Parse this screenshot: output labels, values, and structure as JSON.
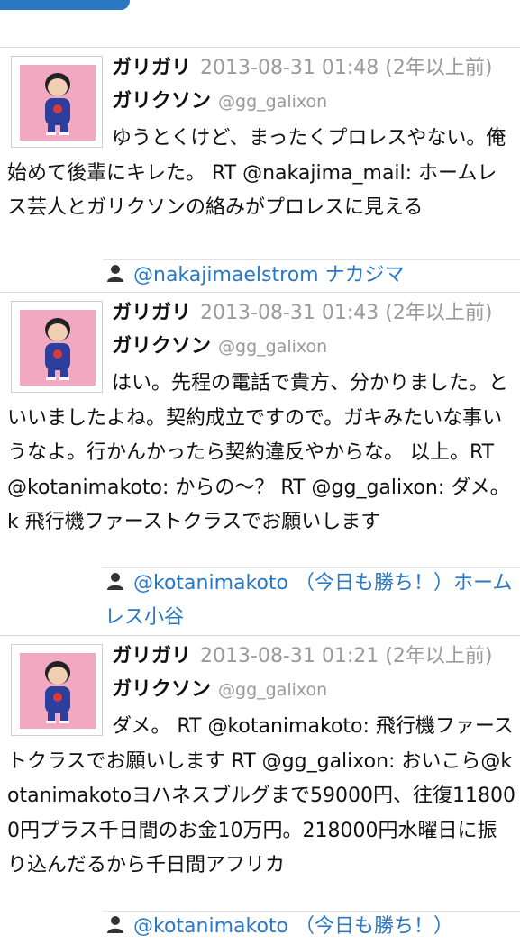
{
  "tweets": [
    {
      "name": "ガリガリ",
      "date": "2013-08-31 01:48 (2年以上前)",
      "screen_name": "ガリクソン",
      "handle": "@gg_galixon",
      "text": "ゆうとくけど、まったくプロレスやない。俺始めて後輩にキレた。 RT @nakajima_mail: ホームレス芸人とガリクソンの絡みがプロレスに見える",
      "mention": "@nakajimaelstrom ナカジマ"
    },
    {
      "name": "ガリガリ",
      "date": "2013-08-31 01:43 (2年以上前)",
      "screen_name": "ガリクソン",
      "handle": "@gg_galixon",
      "text": "はい。先程の電話で貴方、分かりました。といいましたよね。契約成立ですので。ガキみたいな事いうなよ。行かんかったら契約違反やからな。 以上。RT @kotanimakoto: からの〜？ RT @gg_galixon: ダメ。 k 飛行機ファーストクラスでお願いします",
      "mention": "@kotanimakoto （今日も勝ち！）ホームレス小谷"
    },
    {
      "name": "ガリガリ",
      "date": "2013-08-31 01:21 (2年以上前)",
      "screen_name": "ガリクソン",
      "handle": "@gg_galixon",
      "text": "ダメ。 RT @kotanimakoto: 飛行機ファーストクラスでお願いします RT @gg_galixon: おいこら@kotanimakotoヨハネスブルグまで59000円、往復118000円プラス千日間のお金10万円。218000円水曜日に振り込んだるから千日間アフリカ",
      "mention": "@kotanimakoto （今日も勝ち！）"
    }
  ],
  "colors": {
    "accent": "#2a78c4",
    "muted": "#9a9a9a",
    "avatar_bg": "#f3a8c2"
  },
  "icons": {
    "avatar": "character-avatar-icon",
    "mention": "person-icon"
  }
}
